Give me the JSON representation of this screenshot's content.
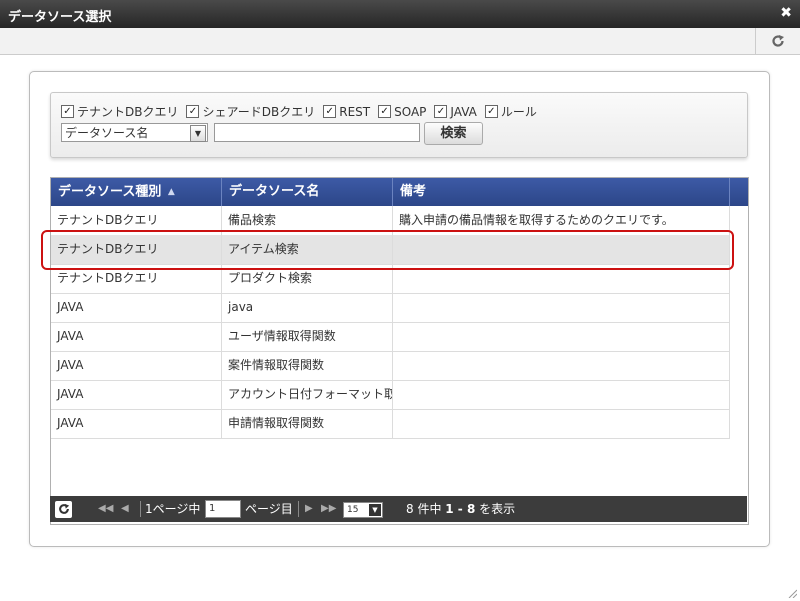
{
  "window": {
    "title": "データソース選択",
    "close_label": "✖"
  },
  "filters": [
    {
      "label": "テナントDBクエリ",
      "checked": true
    },
    {
      "label": "シェアードDBクエリ",
      "checked": true
    },
    {
      "label": "REST",
      "checked": true
    },
    {
      "label": "SOAP",
      "checked": true
    },
    {
      "label": "JAVA",
      "checked": true
    },
    {
      "label": "ルール",
      "checked": true
    }
  ],
  "search": {
    "select_value": "データソース名",
    "input_value": "",
    "button_label": "検索"
  },
  "table": {
    "headers": [
      "データソース種別",
      "データソース名",
      "備考"
    ],
    "sort_icon": "▲▼",
    "rows": [
      [
        "テナントDBクエリ",
        "備品検索",
        "購入申請の備品情報を取得するためのクエリです。"
      ],
      [
        "テナントDBクエリ",
        "アイテム検索",
        ""
      ],
      [
        "テナントDBクエリ",
        "プロダクト検索",
        ""
      ],
      [
        "JAVA",
        "java",
        ""
      ],
      [
        "JAVA",
        "ユーザ情報取得関数",
        ""
      ],
      [
        "JAVA",
        "案件情報取得関数",
        ""
      ],
      [
        "JAVA",
        "アカウント日付フォーマット取得関数",
        ""
      ],
      [
        "JAVA",
        "申請情報取得関数",
        ""
      ]
    ],
    "selected_row": 1
  },
  "pager": {
    "page_prefix": "1ページ中",
    "page_value": "1",
    "page_suffix": "ページ目",
    "page_size": "15",
    "summary_prefix": "8 件中 ",
    "summary_range": "1 - 8",
    "summary_suffix": " を表示"
  },
  "colors": {
    "header": "#2f4a8e",
    "highlight": "#cc1111",
    "pager": "#3c3c3c"
  }
}
